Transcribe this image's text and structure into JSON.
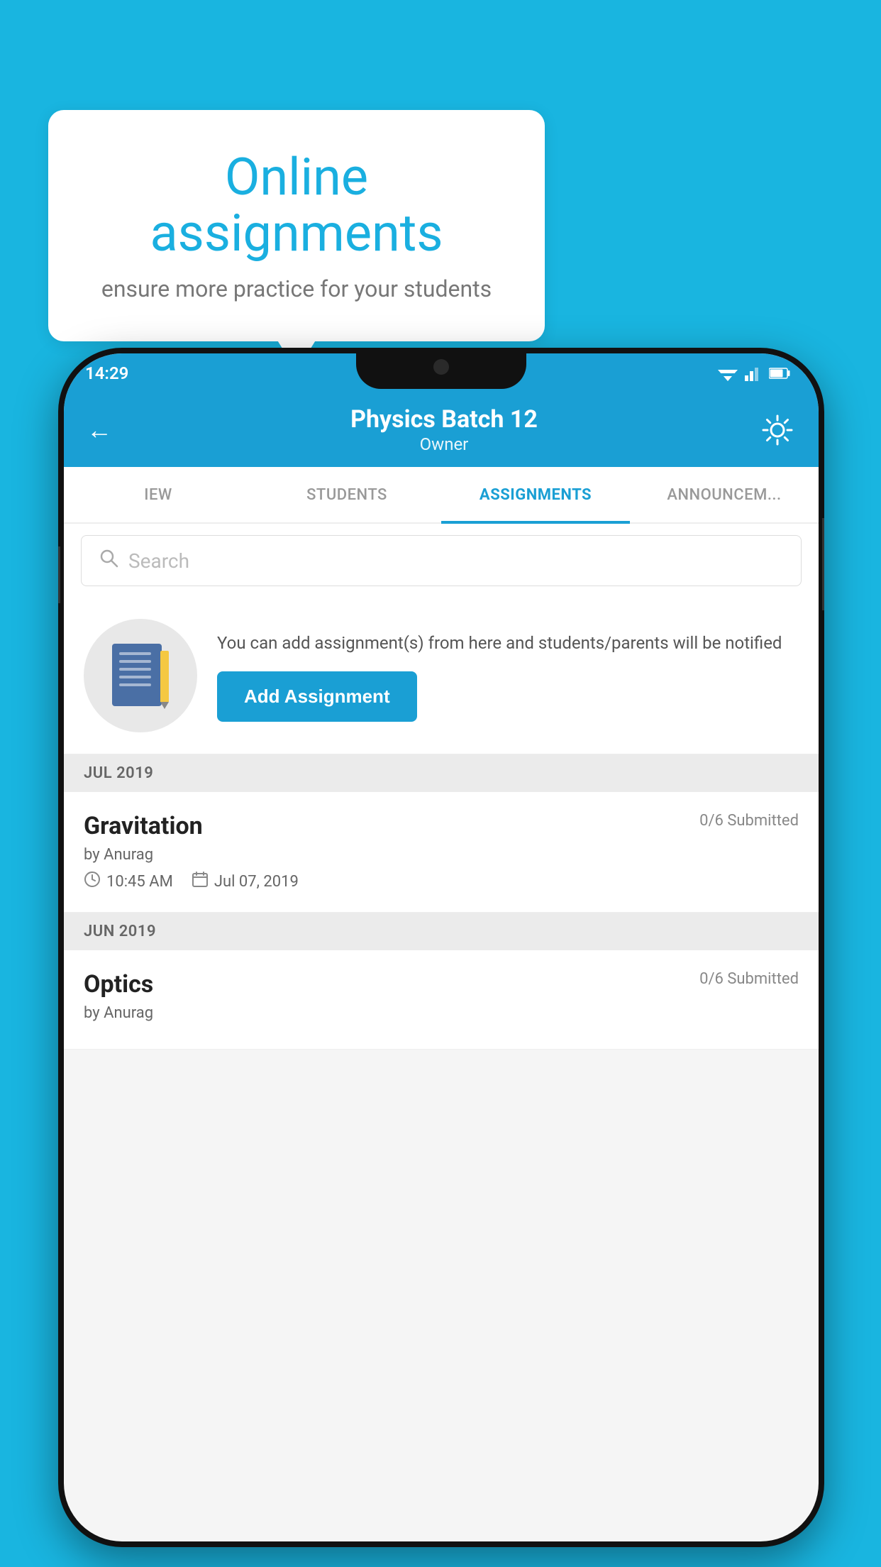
{
  "background_color": "#19b5e0",
  "speech_bubble": {
    "title": "Online assignments",
    "subtitle": "ensure more practice for your students"
  },
  "status_bar": {
    "time": "14:29",
    "signal_icon": "▼◀▌"
  },
  "header": {
    "title": "Physics Batch 12",
    "subtitle": "Owner",
    "back_label": "←",
    "settings_label": "⚙"
  },
  "tabs": [
    {
      "label": "IEW",
      "active": false
    },
    {
      "label": "STUDENTS",
      "active": false
    },
    {
      "label": "ASSIGNMENTS",
      "active": true
    },
    {
      "label": "ANNOUNCEM...",
      "active": false
    }
  ],
  "search": {
    "placeholder": "Search"
  },
  "promo": {
    "description": "You can add assignment(s) from here and students/parents will be notified",
    "add_button_label": "Add Assignment"
  },
  "sections": [
    {
      "header": "JUL 2019",
      "assignments": [
        {
          "name": "Gravitation",
          "submitted": "0/6 Submitted",
          "author": "by Anurag",
          "time": "10:45 AM",
          "date": "Jul 07, 2019"
        }
      ]
    },
    {
      "header": "JUN 2019",
      "assignments": [
        {
          "name": "Optics",
          "submitted": "0/6 Submitted",
          "author": "by Anurag",
          "time": "",
          "date": ""
        }
      ]
    }
  ]
}
